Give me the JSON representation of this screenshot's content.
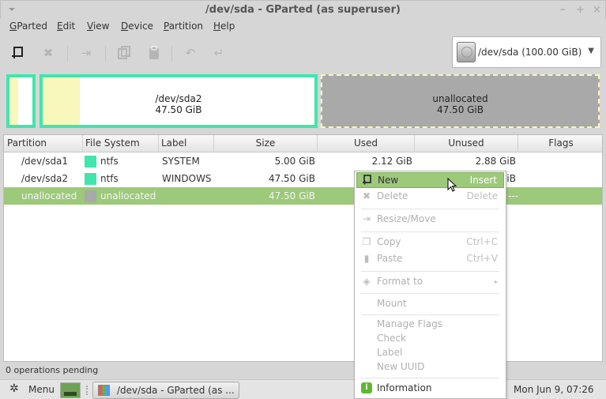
{
  "window": {
    "title": "/dev/sda - GParted (as superuser)",
    "controls": [
      "minimize",
      "maximize",
      "close"
    ]
  },
  "menubar": [
    {
      "label": "GParted",
      "mnemonic": "G"
    },
    {
      "label": "Edit",
      "mnemonic": "E"
    },
    {
      "label": "View",
      "mnemonic": "V"
    },
    {
      "label": "Device",
      "mnemonic": "D"
    },
    {
      "label": "Partition",
      "mnemonic": "P"
    },
    {
      "label": "Help",
      "mnemonic": "H"
    }
  ],
  "toolbar": {
    "buttons": [
      {
        "name": "new",
        "icon": "new-partition-icon",
        "enabled": true
      },
      {
        "name": "delete",
        "icon": "delete-icon",
        "enabled": false
      },
      {
        "name": "resize-move",
        "icon": "resize-move-icon",
        "enabled": false
      },
      {
        "name": "copy",
        "icon": "copy-icon",
        "enabled": false
      },
      {
        "name": "paste",
        "icon": "paste-icon",
        "enabled": false
      },
      {
        "name": "undo",
        "icon": "undo-icon",
        "enabled": false
      },
      {
        "name": "apply",
        "icon": "apply-icon",
        "enabled": false
      }
    ]
  },
  "device_selector": {
    "label": "/dev/sda  (100.00 GiB)",
    "icon": "hard-disk-icon"
  },
  "disk_map": {
    "partitions": [
      {
        "name": "/dev/sda1",
        "size": "5.00 GiB",
        "type": "ntfs",
        "used_fraction": 0.424
      },
      {
        "name": "/dev/sda2",
        "size": "47.50 GiB",
        "type": "ntfs",
        "used_fraction": 0.14,
        "line1": "/dev/sda2",
        "line2": "47.50 GiB"
      },
      {
        "name": "unallocated",
        "size": "47.50 GiB",
        "type": "unallocated",
        "line1": "unallocated",
        "line2": "47.50 GiB"
      }
    ],
    "colors": {
      "ntfs": "#42e5ac",
      "used": "#f8f8bc",
      "unallocated": "#a9a9a9"
    }
  },
  "table": {
    "columns": [
      "Partition",
      "File System",
      "Label",
      "Size",
      "Used",
      "Unused",
      "Flags"
    ],
    "rows": [
      {
        "partition": "/dev/sda1",
        "fs": "ntfs",
        "fs_color": "#42e5ac",
        "label": "SYSTEM",
        "size": "5.00 GiB",
        "used": "2.12 GiB",
        "unused": "2.88 GiB",
        "flags": ""
      },
      {
        "partition": "/dev/sda2",
        "fs": "ntfs",
        "fs_color": "#42e5ac",
        "label": "WINDOWS",
        "size": "47.50 GiB",
        "used": "",
        "unused": "iB",
        "flags": ""
      },
      {
        "partition": "unallocated",
        "fs": "unallocated",
        "fs_color": "#a9a9a9",
        "label": "",
        "size": "47.50 GiB",
        "used": "",
        "unused": "---",
        "flags": "",
        "selected": true
      }
    ]
  },
  "context_menu": {
    "items": [
      {
        "label": "New",
        "shortcut": "Insert",
        "icon": "new-partition-icon",
        "enabled": true,
        "hover": true
      },
      {
        "label": "Delete",
        "shortcut": "Delete",
        "icon": "delete-icon",
        "enabled": false
      },
      {
        "separator": true
      },
      {
        "label": "Resize/Move",
        "shortcut": "",
        "icon": "resize-move-icon",
        "enabled": false
      },
      {
        "separator": true
      },
      {
        "label": "Copy",
        "shortcut": "Ctrl+C",
        "icon": "copy-icon",
        "enabled": false
      },
      {
        "label": "Paste",
        "shortcut": "Ctrl+V",
        "icon": "paste-icon",
        "enabled": false
      },
      {
        "separator": true
      },
      {
        "label": "Format to",
        "shortcut": "▸",
        "icon": "format-icon",
        "enabled": false
      },
      {
        "separator": true
      },
      {
        "label": "Mount",
        "shortcut": "",
        "icon": "",
        "enabled": false
      },
      {
        "separator": true
      },
      {
        "label": "Manage Flags",
        "shortcut": "",
        "icon": "",
        "enabled": false
      },
      {
        "label": "Check",
        "shortcut": "",
        "icon": "",
        "enabled": false
      },
      {
        "label": "Label",
        "shortcut": "",
        "icon": "",
        "enabled": false
      },
      {
        "label": "New UUID",
        "shortcut": "",
        "icon": "",
        "enabled": false
      },
      {
        "separator": true
      },
      {
        "label": "Information",
        "shortcut": "",
        "icon": "information-icon",
        "enabled": true
      }
    ]
  },
  "statusbar": {
    "text": "0 operations pending"
  },
  "taskbar": {
    "menu_label": "Menu",
    "task_label": "/dev/sda - GParted (as ...",
    "clock": "Mon Jun  9, 07:26"
  },
  "colors": {
    "selection": "#9dc97a",
    "ntfs": "#42e5ac",
    "unallocated": "#a9a9a9"
  }
}
